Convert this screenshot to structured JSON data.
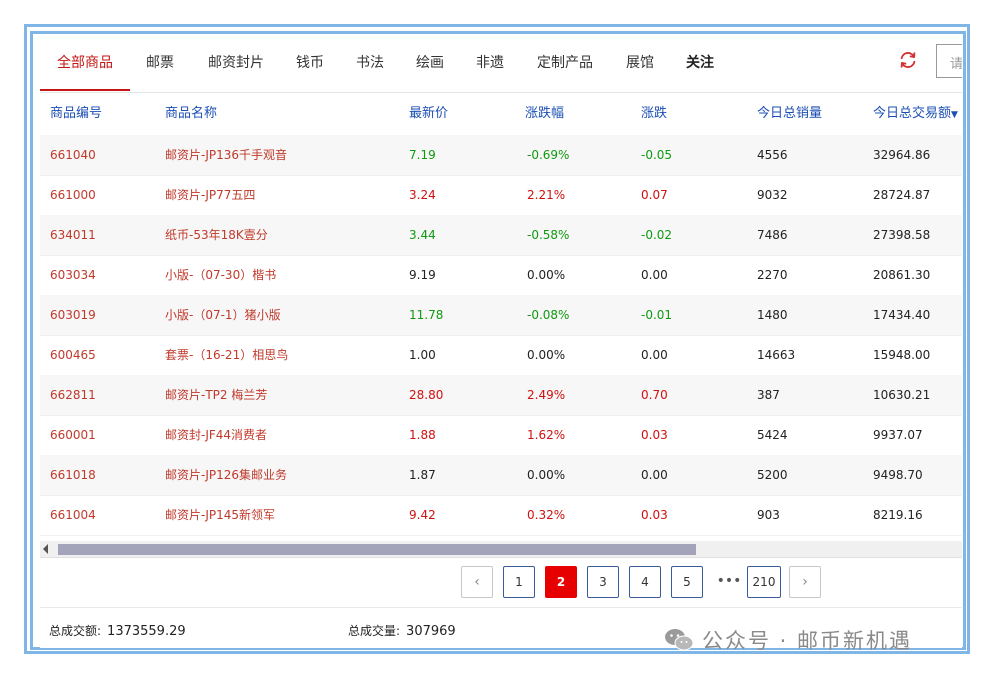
{
  "tabs": [
    {
      "label": "全部商品",
      "active": true
    },
    {
      "label": "邮票"
    },
    {
      "label": "邮资封片"
    },
    {
      "label": "钱币"
    },
    {
      "label": "书法"
    },
    {
      "label": "绘画"
    },
    {
      "label": "非遗"
    },
    {
      "label": "定制产品"
    },
    {
      "label": "展馆"
    },
    {
      "label": "关注"
    }
  ],
  "search": {
    "placeholder": "请"
  },
  "icons": {
    "refresh": "refresh-icon",
    "sort": "sort-down-icon",
    "wechat": "wechat-icon"
  },
  "colors": {
    "accent": "#c51515",
    "header_text": "#1c4fb4",
    "up": "#d01010",
    "down": "#109a10",
    "page_active": "#e60000"
  },
  "table": {
    "columns": [
      "商品编号",
      "商品名称",
      "最新价",
      "涨跌幅",
      "涨跌",
      "今日总销量",
      "今日总交易额"
    ],
    "rows": [
      {
        "code": "661040",
        "name": "邮资片-JP136千手观音",
        "price": "7.19",
        "pct": "-0.69%",
        "change": "-0.05",
        "volume": "4556",
        "amount": "32964.86",
        "trend": "down"
      },
      {
        "code": "661000",
        "name": "邮资片-JP77五四",
        "price": "3.24",
        "pct": "2.21%",
        "change": "0.07",
        "volume": "9032",
        "amount": "28724.87",
        "trend": "up"
      },
      {
        "code": "634011",
        "name": "纸币-53年18K壹分",
        "price": "3.44",
        "pct": "-0.58%",
        "change": "-0.02",
        "volume": "7486",
        "amount": "27398.58",
        "trend": "down"
      },
      {
        "code": "603034",
        "name": "小版-（07-30）楷书",
        "price": "9.19",
        "pct": "0.00%",
        "change": "0.00",
        "volume": "2270",
        "amount": "20861.30",
        "trend": "flat"
      },
      {
        "code": "603019",
        "name": "小版-（07-1）猪小版",
        "price": "11.78",
        "pct": "-0.08%",
        "change": "-0.01",
        "volume": "1480",
        "amount": "17434.40",
        "trend": "down"
      },
      {
        "code": "600465",
        "name": "套票-（16-21）相思鸟",
        "price": "1.00",
        "pct": "0.00%",
        "change": "0.00",
        "volume": "14663",
        "amount": "15948.00",
        "trend": "flat"
      },
      {
        "code": "662811",
        "name": "邮资片-TP2 梅兰芳",
        "price": "28.80",
        "pct": "2.49%",
        "change": "0.70",
        "volume": "387",
        "amount": "10630.21",
        "trend": "up"
      },
      {
        "code": "660001",
        "name": "邮资封-JF44消费者",
        "price": "1.88",
        "pct": "1.62%",
        "change": "0.03",
        "volume": "5424",
        "amount": "9937.07",
        "trend": "up"
      },
      {
        "code": "661018",
        "name": "邮资片-JP126集邮业务",
        "price": "1.87",
        "pct": "0.00%",
        "change": "0.00",
        "volume": "5200",
        "amount": "9498.70",
        "trend": "flat"
      },
      {
        "code": "661004",
        "name": "邮资片-JP145新领军",
        "price": "9.42",
        "pct": "0.32%",
        "change": "0.03",
        "volume": "903",
        "amount": "8219.16",
        "trend": "up"
      }
    ]
  },
  "pagination": {
    "prev": "‹",
    "next": "›",
    "pages": [
      "1",
      "2",
      "3",
      "4",
      "5"
    ],
    "current": "2",
    "ellipsis": "•••",
    "last": "210"
  },
  "footer": {
    "turnover_label": "总成交额:",
    "turnover_value": "1373559.29",
    "volume_label": "总成交量:",
    "volume_value": "307969"
  },
  "watermark": {
    "text": "公众号 · 邮币新机遇"
  }
}
